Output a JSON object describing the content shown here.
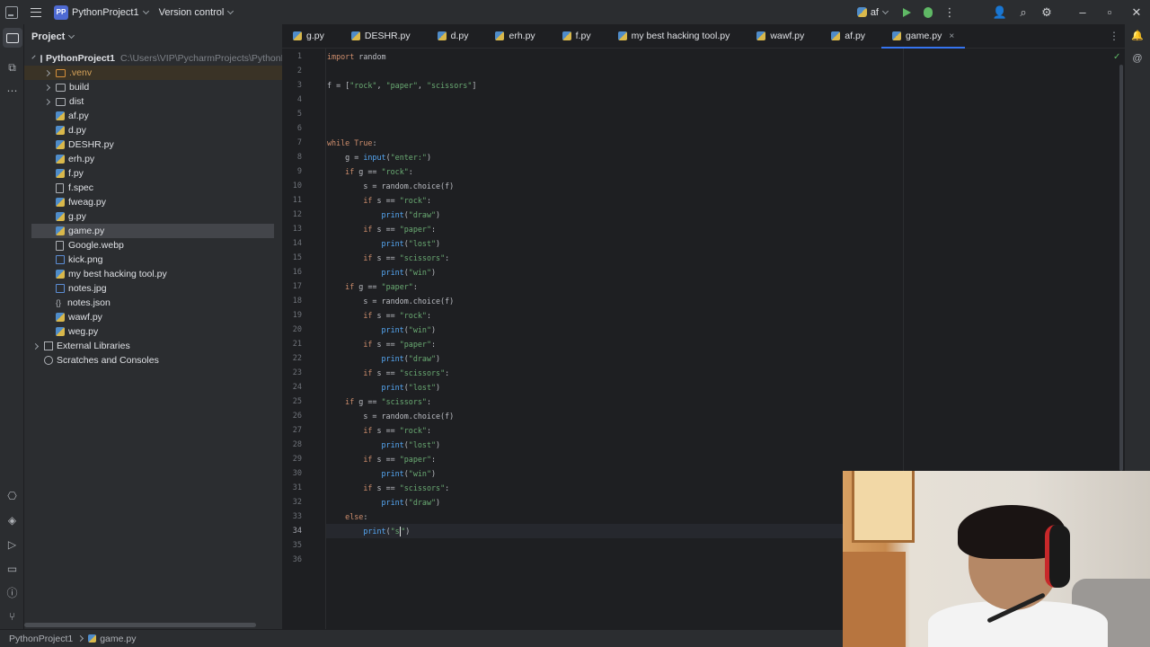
{
  "titlebar": {
    "project_badge": "PP",
    "project_name": "PythonProject1",
    "version_control": "Version control",
    "run_config": "af"
  },
  "project_panel": {
    "header": "Project",
    "root_name": "PythonProject1",
    "root_path": "C:\\Users\\VIP\\PycharmProjects\\PythonPro",
    "items": [
      {
        "label": ".venv",
        "kind": "folder-excluded"
      },
      {
        "label": "build",
        "kind": "folder"
      },
      {
        "label": "dist",
        "kind": "folder"
      },
      {
        "label": "af.py",
        "kind": "python"
      },
      {
        "label": "d.py",
        "kind": "python"
      },
      {
        "label": "DESHR.py",
        "kind": "python"
      },
      {
        "label": "erh.py",
        "kind": "python"
      },
      {
        "label": "f.py",
        "kind": "python"
      },
      {
        "label": "f.spec",
        "kind": "file"
      },
      {
        "label": "fweag.py",
        "kind": "python"
      },
      {
        "label": "g.py",
        "kind": "python"
      },
      {
        "label": "game.py",
        "kind": "python"
      },
      {
        "label": "Google.webp",
        "kind": "file"
      },
      {
        "label": "kick.png",
        "kind": "image"
      },
      {
        "label": "my best hacking tool.py",
        "kind": "python"
      },
      {
        "label": "notes.jpg",
        "kind": "image"
      },
      {
        "label": "notes.json",
        "kind": "json"
      },
      {
        "label": "wawf.py",
        "kind": "python"
      },
      {
        "label": "weg.py",
        "kind": "python"
      }
    ],
    "external_libraries": "External Libraries",
    "scratches": "Scratches and Consoles"
  },
  "tabs": [
    {
      "label": "g.py"
    },
    {
      "label": "DESHR.py"
    },
    {
      "label": "d.py"
    },
    {
      "label": "erh.py"
    },
    {
      "label": "f.py"
    },
    {
      "label": "my best hacking tool.py"
    },
    {
      "label": "wawf.py"
    },
    {
      "label": "af.py"
    },
    {
      "label": "game.py",
      "active": true,
      "close": "×"
    }
  ],
  "editor": {
    "current_line": 34,
    "lines": [
      "import random",
      "",
      "f = [\"rock\", \"paper\", \"scissors\"]",
      "",
      "",
      "",
      "while True:",
      "    g = input(\"enter:\")",
      "    if g == \"rock\":",
      "        s = random.choice(f)",
      "        if s == \"rock\":",
      "            print(\"draw\")",
      "        if s == \"paper\":",
      "            print(\"lost\")",
      "        if s == \"scissors\":",
      "            print(\"win\")",
      "    if g == \"paper\":",
      "        s = random.choice(f)",
      "        if s == \"rock\":",
      "            print(\"win\")",
      "        if s == \"paper\":",
      "            print(\"draw\")",
      "        if s == \"scissors\":",
      "            print(\"lost\")",
      "    if g == \"scissors\":",
      "        s = random.choice(f)",
      "        if s == \"rock\":",
      "            print(\"lost\")",
      "        if s == \"paper\":",
      "            print(\"win\")",
      "        if s == \"scissors\":",
      "            print(\"draw\")",
      "    else:",
      "        print(\"s\")",
      "",
      ""
    ]
  },
  "statusbar": {
    "breadcrumb": [
      "PythonProject1",
      "game.py"
    ]
  },
  "colors": {
    "keyword": "#cf8e6d",
    "string": "#6aab73",
    "function": "#56a8f5",
    "accent": "#3574f0"
  }
}
